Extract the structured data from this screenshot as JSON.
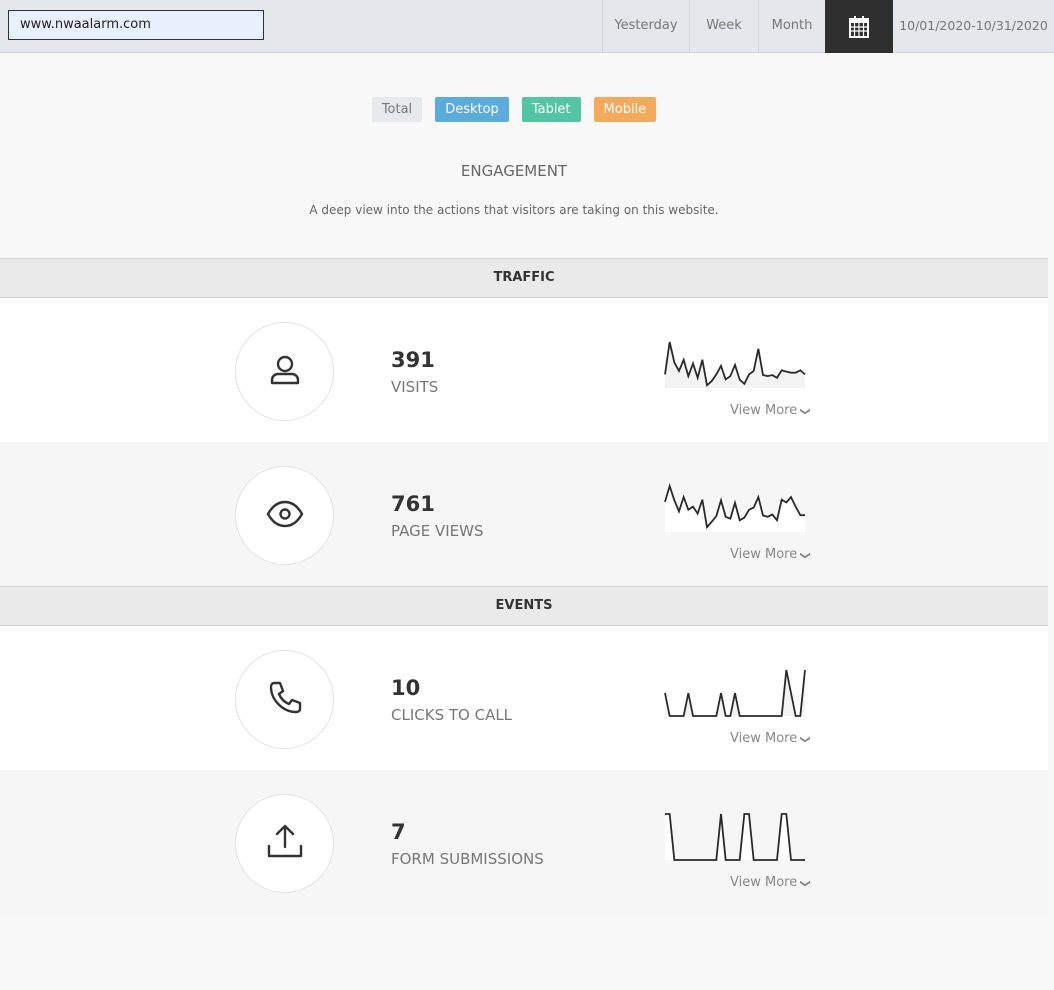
{
  "header": {
    "site": "www.nwaalarm.com",
    "ranges": [
      "Yesterday",
      "Week",
      "Month"
    ],
    "date_range": "10/01/2020-10/31/2020"
  },
  "filters": [
    {
      "label": "Total",
      "color": "#e7e9ec",
      "text": "#777"
    },
    {
      "label": "Desktop",
      "color": "#5aacdc",
      "text": "#fff"
    },
    {
      "label": "Tablet",
      "color": "#52c5a5",
      "text": "#fff"
    },
    {
      "label": "Mobile",
      "color": "#f3aa5a",
      "text": "#fff"
    }
  ],
  "title": "ENGAGEMENT",
  "subtitle": "A deep view into the actions that visitors are taking on this website.",
  "sections": {
    "traffic": "TRAFFIC",
    "events": "EVENTS"
  },
  "view_more": "View More",
  "metrics": [
    {
      "value": "391",
      "label": "VISITS",
      "icon": "user-icon",
      "spark": [
        40,
        135,
        75,
        50,
        83,
        35,
        72,
        30,
        83,
        8,
        20,
        40,
        65,
        25,
        35,
        68,
        25,
        12,
        40,
        50,
        115,
        38,
        35,
        38,
        30,
        52,
        48,
        45,
        45,
        52,
        40
      ]
    },
    {
      "value": "761",
      "label": "PAGE VIEWS",
      "icon": "eye-icon",
      "spark": [
        95,
        145,
        100,
        65,
        110,
        70,
        80,
        58,
        102,
        15,
        32,
        50,
        100,
        48,
        42,
        92,
        37,
        45,
        70,
        77,
        110,
        52,
        48,
        55,
        37,
        102,
        93,
        110,
        80,
        53,
        53
      ]
    },
    {
      "value": "10",
      "label": "CLICKS TO CALL",
      "icon": "phone-icon",
      "spark": [
        1,
        0,
        0,
        0,
        0,
        1,
        0,
        0,
        0,
        0,
        0,
        0,
        1,
        0,
        0,
        1,
        0,
        0,
        0,
        0,
        0,
        0,
        0,
        0,
        0,
        0,
        2,
        1,
        0,
        0,
        2
      ]
    },
    {
      "value": "7",
      "label": "FORM SUBMISSIONS",
      "icon": "upload-icon",
      "spark": [
        1,
        1,
        0,
        0,
        0,
        0,
        0,
        0,
        0,
        0,
        0,
        0,
        1,
        0,
        0,
        0,
        0,
        1,
        1,
        0,
        0,
        0,
        0,
        0,
        0,
        1,
        1,
        0,
        0,
        0,
        0
      ]
    }
  ]
}
